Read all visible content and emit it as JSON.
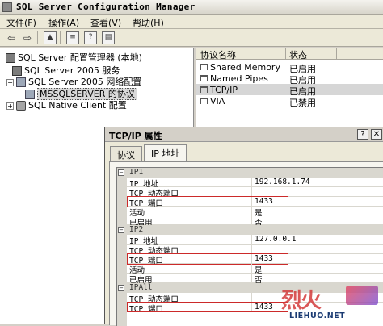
{
  "window": {
    "title": "SQL Server Configuration Manager"
  },
  "menu": [
    {
      "label": "文件(F)"
    },
    {
      "label": "操作(A)"
    },
    {
      "label": "查看(V)"
    },
    {
      "label": "帮助(H)"
    }
  ],
  "toolbar": {
    "icons": [
      "back-arrow-icon",
      "forward-arrow-icon",
      "up-folder-icon",
      "properties-icon",
      "help-icon",
      "show-hide-icon"
    ]
  },
  "tree": {
    "root": "SQL Server 配置管理器 (本地)",
    "services": "SQL Server 2005 服务",
    "network": "SQL Server 2005 网络配置",
    "instance": "MSSQLSERVER 的协议",
    "native_client": "SQL Native Client 配置"
  },
  "list": {
    "columns": [
      "协议名称",
      "状态"
    ],
    "rows": [
      {
        "name": "Shared Memory",
        "state": "已启用"
      },
      {
        "name": "Named Pipes",
        "state": "已启用"
      },
      {
        "name": "TCP/IP",
        "state": "已启用"
      },
      {
        "name": "VIA",
        "state": "已禁用"
      }
    ]
  },
  "dialog": {
    "title": "TCP/IP 属性",
    "help_glyph": "?",
    "close_glyph": "✕",
    "tabs": [
      "协议",
      "IP 地址"
    ],
    "groups": [
      {
        "label": "IP1",
        "props": [
          {
            "name": "IP 地址",
            "value": "192.168.1.74"
          },
          {
            "name": "TCP 动态端口",
            "value": ""
          },
          {
            "name": "TCP 端口",
            "value": "1433"
          },
          {
            "name": "活动",
            "value": "是"
          },
          {
            "name": "已启用",
            "value": "否"
          }
        ]
      },
      {
        "label": "IP2",
        "props": [
          {
            "name": "IP 地址",
            "value": "127.0.0.1"
          },
          {
            "name": "TCP 动态端口",
            "value": ""
          },
          {
            "name": "TCP 端口",
            "value": "1433"
          },
          {
            "name": "活动",
            "value": "是"
          },
          {
            "name": "已启用",
            "value": "否"
          }
        ]
      },
      {
        "label": "IPAll",
        "props": [
          {
            "name": "TCP 动态端口",
            "value": ""
          },
          {
            "name": "TCP 端口",
            "value": "1433"
          }
        ]
      }
    ]
  },
  "watermark": {
    "logo": "烈火",
    "url": "LIEHUO.NET"
  },
  "colors": {
    "highlight": "#cc2a2a",
    "selection": "#d6d6d6"
  }
}
